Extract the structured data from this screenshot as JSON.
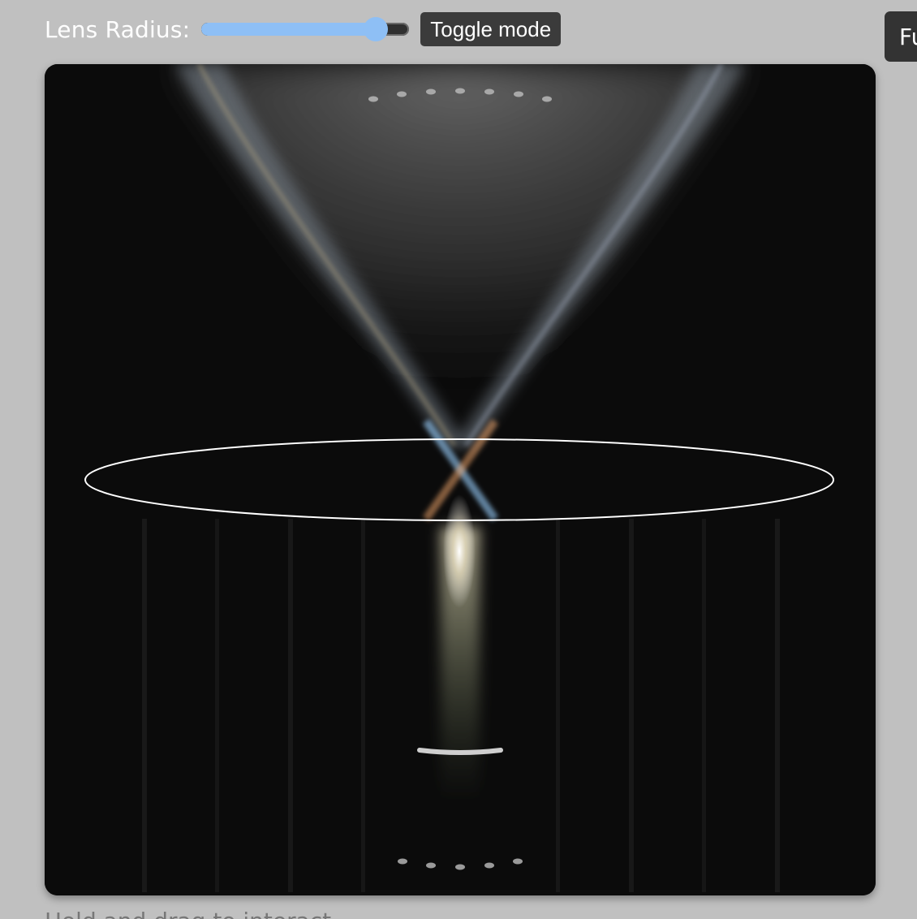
{
  "controls": {
    "lens_radius_label": "Lens Radius:",
    "lens_radius_value": 0.84,
    "toggle_label": "Toggle mode",
    "right_button_label": "Fu"
  },
  "caption": "Hold and drag to interact",
  "colors": {
    "page_background": "#c0c0c0",
    "slider_fill": "#8ebff5",
    "button_background": "#3b3b3b",
    "canvas_background": "#0a0a0a",
    "lens_outline": "#ffffff"
  },
  "icons": []
}
